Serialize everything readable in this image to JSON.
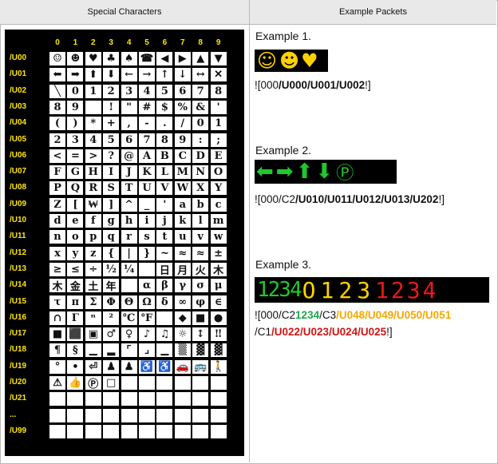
{
  "headers": {
    "left": "Special Characters",
    "right": "Example Packets"
  },
  "table": {
    "col_labels": [
      "0",
      "1",
      "2",
      "3",
      "4",
      "5",
      "6",
      "7",
      "8",
      "9"
    ],
    "rows": [
      {
        "label": "/U00",
        "cells": [
          "☺",
          "☻",
          "♥",
          "♣",
          "♠",
          "☎",
          "◀",
          "▶",
          "▲",
          "▼"
        ]
      },
      {
        "label": "/U01",
        "cells": [
          "⬅",
          "➡",
          "⬆",
          "⬇",
          "←",
          "→",
          "↑",
          "↓",
          "↔",
          "✕"
        ]
      },
      {
        "label": "/U02",
        "cells": [
          "╲",
          "0",
          "1",
          "2",
          "3",
          "4",
          "5",
          "6",
          "7",
          "8"
        ]
      },
      {
        "label": "/U03",
        "cells": [
          "8",
          "9",
          " ",
          "!",
          "\"",
          "#",
          "$",
          "%",
          "&",
          "'"
        ]
      },
      {
        "label": "/U04",
        "cells": [
          "(",
          ")",
          "*",
          "+",
          ",",
          "-",
          ".",
          "/",
          "0",
          "1"
        ]
      },
      {
        "label": "/U05",
        "cells": [
          "2",
          "3",
          "4",
          "5",
          "6",
          "7",
          "8",
          "9",
          ":",
          ";"
        ]
      },
      {
        "label": "/U06",
        "cells": [
          "<",
          "=",
          ">",
          "?",
          "@",
          "A",
          "B",
          "C",
          "D",
          "E"
        ]
      },
      {
        "label": "/U07",
        "cells": [
          "F",
          "G",
          "H",
          "I",
          "J",
          "K",
          "L",
          "M",
          "N",
          "O"
        ]
      },
      {
        "label": "/U08",
        "cells": [
          "P",
          "Q",
          "R",
          "S",
          "T",
          "U",
          "V",
          "W",
          "X",
          "Y"
        ]
      },
      {
        "label": "/U09",
        "cells": [
          "Z",
          "[",
          "₩",
          "]",
          "^",
          "_",
          "'",
          "a",
          "b",
          "c"
        ]
      },
      {
        "label": "/U10",
        "cells": [
          "d",
          "e",
          "f",
          "g",
          "h",
          "i",
          "j",
          "k",
          "l",
          "m"
        ]
      },
      {
        "label": "/U11",
        "cells": [
          "n",
          "o",
          "p",
          "q",
          "r",
          "s",
          "t",
          "u",
          "v",
          "w"
        ]
      },
      {
        "label": "/U12",
        "cells": [
          "x",
          "y",
          "z",
          "{",
          "|",
          "}",
          "~",
          "≈",
          "≈",
          "±"
        ]
      },
      {
        "label": "/U13",
        "cells": [
          "≥",
          "≤",
          "÷",
          "½",
          "¼",
          " ",
          "日",
          "月",
          "火",
          "木"
        ]
      },
      {
        "label": "/U14",
        "cells": [
          "木",
          "金",
          "土",
          "年",
          " ",
          "α",
          "β",
          "γ",
          "σ",
          "μ"
        ]
      },
      {
        "label": "/U15",
        "cells": [
          "τ",
          "π",
          "Σ",
          "Φ",
          "Θ",
          "Ω",
          "δ",
          "∞",
          "φ",
          "∈"
        ]
      },
      {
        "label": "/U16",
        "cells": [
          "∩",
          "Γ",
          "ⁿ",
          "²",
          "℃",
          "℉",
          " ",
          "◆",
          "■",
          "●"
        ]
      },
      {
        "label": "/U17",
        "cells": [
          "■",
          "⬛",
          "▣",
          "♂",
          "♀",
          "♪",
          "♫",
          "☼",
          "↕",
          "‼"
        ]
      },
      {
        "label": "/U18",
        "cells": [
          "¶",
          "§",
          "▁",
          "▂",
          "⌜",
          "⌟",
          "▁",
          "▒",
          "▓",
          "▓"
        ]
      },
      {
        "label": "/U19",
        "cells": [
          "°",
          "•",
          "⏎",
          "♟",
          "♟",
          "♿",
          "♿",
          "🚗",
          "🚌",
          "🚶"
        ]
      },
      {
        "label": "/U20",
        "cells": [
          "⚠",
          "👍",
          "Ⓟ",
          "□",
          " ",
          " ",
          " ",
          " ",
          " ",
          " "
        ]
      },
      {
        "label": "/U21",
        "cells": [
          " ",
          " ",
          " ",
          " ",
          " ",
          " ",
          " ",
          " ",
          " ",
          " "
        ]
      },
      {
        "label": "...",
        "cells": [
          " ",
          " ",
          " ",
          " ",
          " ",
          " ",
          " ",
          " ",
          " ",
          " "
        ]
      },
      {
        "label": "/U99",
        "cells": [
          " ",
          " ",
          " ",
          " ",
          " ",
          " ",
          " ",
          " ",
          " ",
          " "
        ]
      }
    ]
  },
  "examples": [
    {
      "title": "Example 1.",
      "glyphs": [
        "☺",
        "☻",
        "♥"
      ],
      "packet_prefix": "![000",
      "packet_bold": "/U000/U001/U002",
      "packet_suffix": "!]"
    },
    {
      "title": "Example 2.",
      "glyphs": [
        "⬅",
        "➡",
        "⬆",
        "⬇",
        "Ⓟ"
      ],
      "packet_prefix": "![000/C2",
      "packet_bold": "/U010/U011/U012/U013/U202",
      "packet_suffix": "!]"
    },
    {
      "title": "Example 3.",
      "led_green": "1234",
      "led_yellow": "O123",
      "led_red": "1234",
      "line1_prefix": "![000/C2",
      "line1_green": "1234",
      "line1_mid": "/C3",
      "line1_orange": "/U048/U049/U050/U051",
      "line2_prefix": "/C1",
      "line2_red": "/U022/U023/U024/U025",
      "line2_suffix": "!]"
    }
  ],
  "colors": {
    "yellow": "#ffe600",
    "green": "#19a84b",
    "orange": "#f5a800",
    "red": "#d11414"
  }
}
